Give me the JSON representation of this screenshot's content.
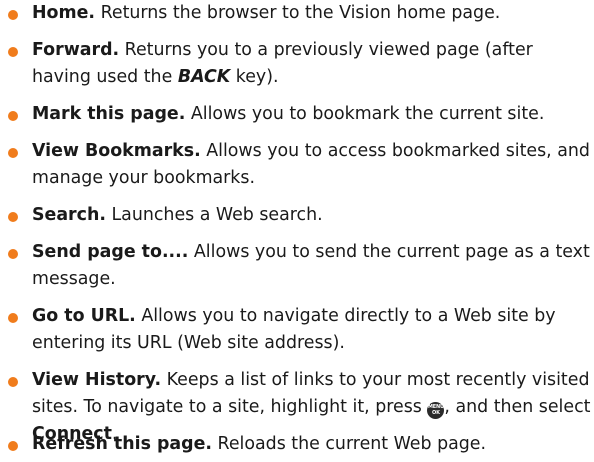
{
  "items": [
    {
      "term": "Home.",
      "desc": "Returns the browser to the Vision home page."
    },
    {
      "term": "Forward.",
      "desc_before": "Returns you to a previously viewed page (after having used the",
      "key": "BACK",
      "desc_after": "key)."
    },
    {
      "term": "Mark this page.",
      "desc": "Allows you to bookmark the current site."
    },
    {
      "term": "View Bookmarks.",
      "desc": "Allows you to access bookmarked sites, and manage your bookmarks."
    },
    {
      "term": "Search.",
      "desc": "Launches a Web search."
    },
    {
      "term": "Send page to....",
      "desc": "Allows you to send the current page as a text message."
    },
    {
      "term": "Go to URL.",
      "desc": "Allows you to navigate directly to a Web site by entering its URL (Web site address)."
    },
    {
      "term": "View History.",
      "desc_before": "Keeps a list of links to your most recently visited sites. To navigate to a site, highlight it, press",
      "icon_top": "MENU",
      "icon_bottom": "OK",
      "desc_middle": ", and then select",
      "connect": "Connect",
      "desc_after": "."
    },
    {
      "term": "Refresh this page.",
      "desc": "Reloads the current Web page."
    }
  ],
  "colors": {
    "bullet": "#f07c1c",
    "text": "#1a1a1a",
    "menu_key_bg": "#2b2b2b"
  },
  "icons": {
    "bullet": "orange-dot-bullet",
    "menu_ok_key": "menu-ok-key-icon"
  }
}
